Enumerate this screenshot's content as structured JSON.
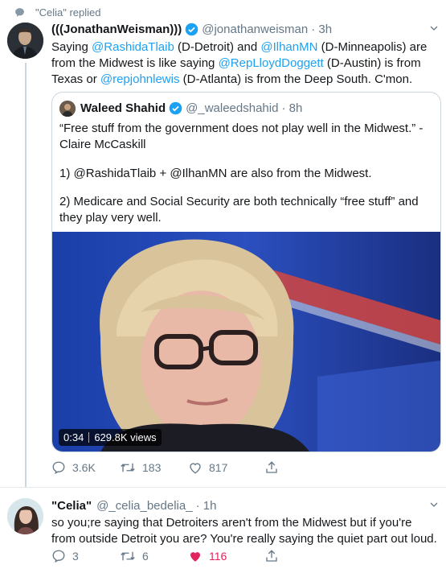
{
  "reply_note": {
    "text": "\"Celia\" replied",
    "icon": "speech-bubble-icon"
  },
  "main_tweet": {
    "display_name": "(((JonathanWeisman)))",
    "handle": "@jonathanweisman",
    "time": "· 3h",
    "verified": true,
    "text_parts": [
      {
        "t": "Saying ",
        "link": false
      },
      {
        "t": "@RashidaTlaib",
        "link": true
      },
      {
        "t": " (D-Detroit) and ",
        "link": false
      },
      {
        "t": "@IlhanMN",
        "link": true
      },
      {
        "t": " (D-Minneapolis) are from the Midwest is like saying ",
        "link": false
      },
      {
        "t": "@RepLloydDoggett",
        "link": true
      },
      {
        "t": " (D-Austin) is from Texas or ",
        "link": false
      },
      {
        "t": "@repjohnlewis",
        "link": true
      },
      {
        "t": " (D-Atlanta) is from the Deep South. C'mon.",
        "link": false
      }
    ],
    "quote": {
      "display_name": "Waleed Shahid",
      "handle": "@_waleedshahid",
      "time": "· 8h",
      "verified": true,
      "para1": "“Free stuff from the government does not play well in the Midwest.” - Claire McCaskill",
      "para2": "1) @RashidaTlaib + @IlhanMN are also from the Midwest.",
      "para3": "2) Medicare and Social Security are both technically “free stuff” and they play very well.",
      "video": {
        "duration": "0:34",
        "views": "629.8K views"
      }
    },
    "actions": {
      "replies": "3.6K",
      "retweets": "183",
      "likes": "817"
    }
  },
  "reply_tweet": {
    "display_name": "\"Celia\"",
    "handle": "@_celia_bedelia_",
    "time": "· 1h",
    "text": "so you;re saying that Detroiters aren't from the Midwest but if you're from outside Detroit you are? You're really saying the quiet part out loud.",
    "actions": {
      "replies": "3",
      "retweets": "6",
      "likes": "116",
      "liked": true
    }
  },
  "colors": {
    "link": "#1da1f2",
    "muted": "#657786",
    "like": "#e0245e",
    "verified": "#1da1f2"
  }
}
